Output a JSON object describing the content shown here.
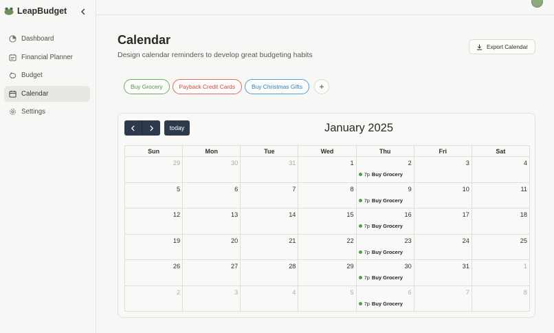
{
  "app": {
    "name": "LeapBudget"
  },
  "sidebar": {
    "items": [
      {
        "label": "Dashboard",
        "icon": "pie-chart-icon",
        "active": false
      },
      {
        "label": "Financial Planner",
        "icon": "planner-icon",
        "active": false
      },
      {
        "label": "Budget",
        "icon": "piggy-bank-icon",
        "active": false
      },
      {
        "label": "Calendar",
        "icon": "calendar-icon",
        "active": true
      },
      {
        "label": "Settings",
        "icon": "gear-icon",
        "active": false
      }
    ]
  },
  "page": {
    "title": "Calendar",
    "subtitle": "Design calendar reminders to develop great budgeting habits",
    "export_label": "Export Calendar"
  },
  "reminders": [
    {
      "label": "Buy Grocery",
      "color": "#4c9b46"
    },
    {
      "label": "Payback Credit Cards",
      "color": "#d2483c"
    },
    {
      "label": "Buy Christmas Gifts",
      "color": "#2d83c4"
    }
  ],
  "add_reminder_label": "+",
  "calendar": {
    "month_title": "January 2025",
    "today_label": "today",
    "weekdays": [
      "Sun",
      "Mon",
      "Tue",
      "Wed",
      "Thu",
      "Fri",
      "Sat"
    ],
    "weeks": [
      [
        {
          "d": "29",
          "o": true
        },
        {
          "d": "30",
          "o": true
        },
        {
          "d": "31",
          "o": true
        },
        {
          "d": "1"
        },
        {
          "d": "2",
          "e": true
        },
        {
          "d": "3"
        },
        {
          "d": "4"
        }
      ],
      [
        {
          "d": "5"
        },
        {
          "d": "6"
        },
        {
          "d": "7"
        },
        {
          "d": "8"
        },
        {
          "d": "9",
          "e": true
        },
        {
          "d": "10"
        },
        {
          "d": "11"
        }
      ],
      [
        {
          "d": "12"
        },
        {
          "d": "13"
        },
        {
          "d": "14"
        },
        {
          "d": "15"
        },
        {
          "d": "16",
          "e": true
        },
        {
          "d": "17"
        },
        {
          "d": "18"
        }
      ],
      [
        {
          "d": "19"
        },
        {
          "d": "20"
        },
        {
          "d": "21"
        },
        {
          "d": "22"
        },
        {
          "d": "23",
          "e": true
        },
        {
          "d": "24"
        },
        {
          "d": "25"
        }
      ],
      [
        {
          "d": "26"
        },
        {
          "d": "27"
        },
        {
          "d": "28"
        },
        {
          "d": "29"
        },
        {
          "d": "30",
          "e": true
        },
        {
          "d": "31"
        },
        {
          "d": "1",
          "o": true
        }
      ],
      [
        {
          "d": "2",
          "o": true
        },
        {
          "d": "3",
          "o": true
        },
        {
          "d": "4",
          "o": true
        },
        {
          "d": "5",
          "o": true
        },
        {
          "d": "6",
          "o": true,
          "e": true
        },
        {
          "d": "7",
          "o": true
        },
        {
          "d": "8",
          "o": true
        }
      ]
    ],
    "event": {
      "time": "7p",
      "title": "Buy Grocery",
      "color": "#4f9e4a"
    }
  }
}
